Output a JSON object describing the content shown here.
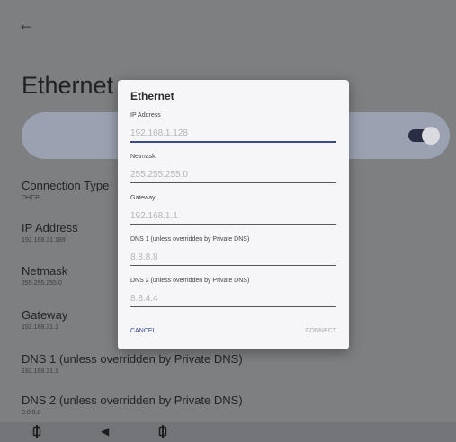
{
  "settings": {
    "title": "Ethernet",
    "prefs": [
      {
        "title": "Connection Type",
        "summary": "DHCP"
      },
      {
        "title": "IP Address",
        "summary": "192.168.31.189"
      },
      {
        "title": "Netmask",
        "summary": "255.255.255.0"
      },
      {
        "title": "Gateway",
        "summary": "192.168.31.1"
      },
      {
        "title": "DNS 1 (unless overridden by Private DNS)",
        "summary": "192.168.31.1"
      },
      {
        "title": "DNS 2 (unless overridden by Private DNS)",
        "summary": "0.0.0.0"
      }
    ],
    "ethernet_toggle_on": true
  },
  "dialog": {
    "title": "Ethernet",
    "fields": [
      {
        "label": "IP Address",
        "hint": "192.168.1.128"
      },
      {
        "label": "Netmask",
        "hint": "255.255.255.0"
      },
      {
        "label": "Gateway",
        "hint": "192.168.1.1"
      },
      {
        "label": "DNS 1 (unless overridden by Private DNS)",
        "hint": "8.8.8.8"
      },
      {
        "label": "DNS 2 (unless overridden by Private DNS)",
        "hint": "8.8.4.4"
      }
    ],
    "cancel_label": "CANCEL",
    "connect_label": "CONNECT"
  },
  "icons": {
    "back": "back-arrow-icon",
    "nav_back": "triangle-back-icon",
    "nav_recents": "recents-icon"
  }
}
